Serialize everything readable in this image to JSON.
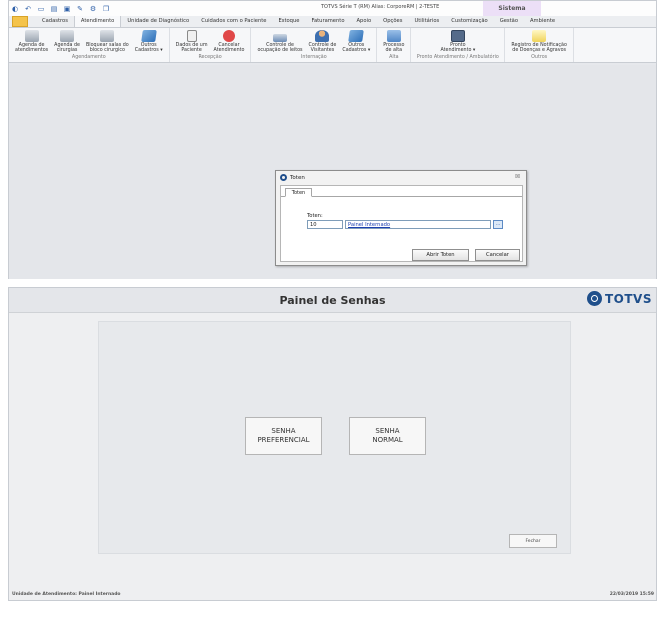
{
  "app": {
    "title": "TOTVS Série T (RM) Alias: CorporeRM | 2-TESTE",
    "sistema_label": "Sistema",
    "tabs": [
      "Cadastros",
      "Atendimento",
      "Unidade de Diagnóstico",
      "Cuidados com o Paciente",
      "Estoque",
      "Faturamento",
      "Apoio",
      "Opções",
      "Utilitários",
      "Customização",
      "Gestão",
      "Ambiente"
    ],
    "active_tab": "Atendimento"
  },
  "ribbon": {
    "groups": [
      {
        "title": "Agendamento",
        "items": [
          "Agenda de\natendimentos",
          "Agenda de\ncirurgias",
          "Bloquear salas do\nbloco cirurgico",
          "Outros\nCadastros ▾"
        ]
      },
      {
        "title": "Recepção",
        "items": [
          "Dados de um\nPaciente",
          "Cancelar\nAtendimento"
        ]
      },
      {
        "title": "Internação",
        "items": [
          "Controle de\nocupação de leitos",
          "Controle de\nVisitantes",
          "Outros\nCadastros ▾"
        ]
      },
      {
        "title": "Alta",
        "items": [
          "Processo\nde alta"
        ]
      },
      {
        "title": "Pronto Atendimento / Ambulatório",
        "items": [
          "Pronto\nAtendimento ▾"
        ]
      },
      {
        "title": "Outros",
        "items": [
          "Registro de Notificação\nde Doenças e Agravos"
        ]
      }
    ]
  },
  "dialog": {
    "title": "Toten",
    "close_glyph": "☒",
    "tab": "Toten",
    "field_label": "Toten:",
    "code_value": "10",
    "description_value": "Painel Internado",
    "lookup_glyph": "...",
    "open_button": "Abrir Toten",
    "cancel_button": "Cancelar"
  },
  "panel": {
    "title": "Painel de Senhas",
    "logo_text": "TOTVS",
    "preferencial_button": "SENHA\nPREFERENCIAL",
    "normal_button": "SENHA\nNORMAL",
    "close_button": "Fechar",
    "status_left": "Unidade de Atendimento: Painel Internado",
    "status_right": "22/03/2019 15:59"
  },
  "colors": {
    "brand": "#1f4f8b",
    "sistema_bg": "#ecdff7",
    "app_button": "#f4c34a"
  }
}
